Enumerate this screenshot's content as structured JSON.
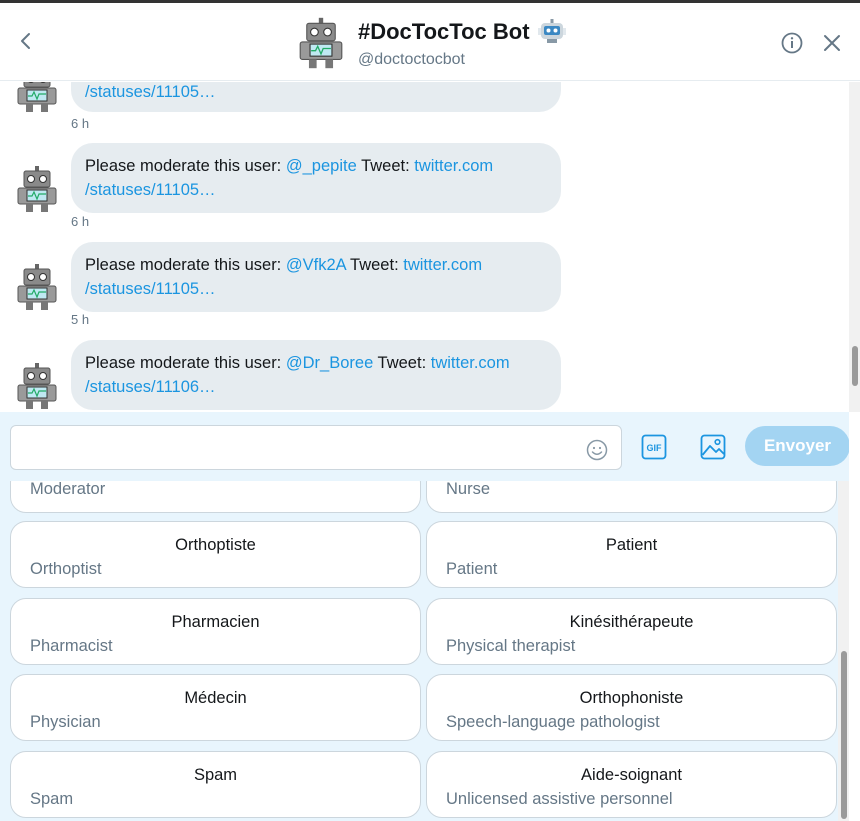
{
  "header": {
    "title": "#DocTocToc Bot",
    "handle": "@doctoctocbot"
  },
  "messages": [
    {
      "link_partial": "/statuses/11105…",
      "time": "6 h"
    },
    {
      "prefix": "Please moderate this user:",
      "user": "@_pepite",
      "tweet_label": "Tweet:",
      "link1": "twitter.com",
      "link2": "/statuses/11105…",
      "time": "6 h"
    },
    {
      "prefix": "Please moderate this user:",
      "user": "@Vfk2A",
      "tweet_label": "Tweet:",
      "link1": "twitter.com",
      "link2": "/statuses/11105…",
      "time": "5 h"
    },
    {
      "prefix": "Please moderate this user:",
      "user": "@Dr_Boree",
      "tweet_label": "Tweet:",
      "link1": "twitter.com",
      "link2": "/statuses/11106…"
    }
  ],
  "composer": {
    "send_label": "Envoyer",
    "gif_label": "GIF"
  },
  "options": [
    {
      "subtitle": "Moderator"
    },
    {
      "subtitle": "Nurse"
    },
    {
      "title": "Orthoptiste",
      "subtitle": "Orthoptist"
    },
    {
      "title": "Patient",
      "subtitle": "Patient"
    },
    {
      "title": "Pharmacien",
      "subtitle": "Pharmacist"
    },
    {
      "title": "Kinésithérapeute",
      "subtitle": "Physical therapist"
    },
    {
      "title": "Médecin",
      "subtitle": "Physician"
    },
    {
      "title": "Orthophoniste",
      "subtitle": "Speech-language pathologist"
    },
    {
      "title": "Spam",
      "subtitle": "Spam"
    },
    {
      "title": "Aide-soignant",
      "subtitle": "Unlicensed assistive personnel"
    }
  ],
  "colors": {
    "accent": "#1b95e0",
    "send_disabled": "#a3d4f2",
    "bubble": "#e6ecf0",
    "option_bg": "#e8f5fd"
  }
}
